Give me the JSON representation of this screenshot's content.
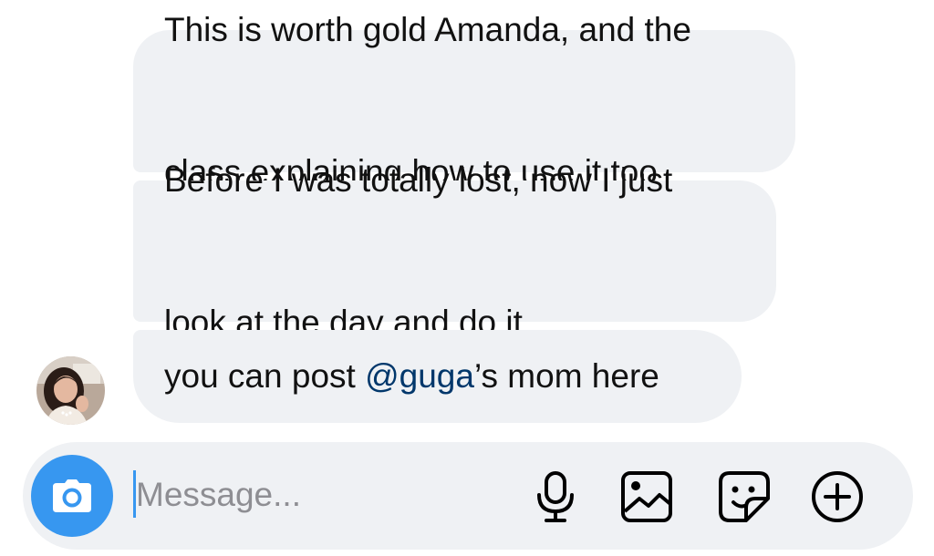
{
  "messages": [
    {
      "lines": [
        "This is worth gold Amanda, and the",
        "class explaining how to use it too"
      ]
    },
    {
      "lines": [
        "Before I was totally lost, now I just",
        "look at the day and do it"
      ]
    },
    {
      "before": "you can post ",
      "mention": "@guga",
      "after": "’s mom here"
    }
  ],
  "composer": {
    "placeholder": "Message...",
    "icons": {
      "camera": "camera-icon",
      "mic": "microphone-icon",
      "gallery": "gallery-icon",
      "sticker": "sticker-icon",
      "plus": "plus-circle-icon"
    }
  },
  "colors": {
    "bubble": "#eff1f4",
    "accent": "#3797f0",
    "mention": "#00376b",
    "text": "#111111"
  }
}
